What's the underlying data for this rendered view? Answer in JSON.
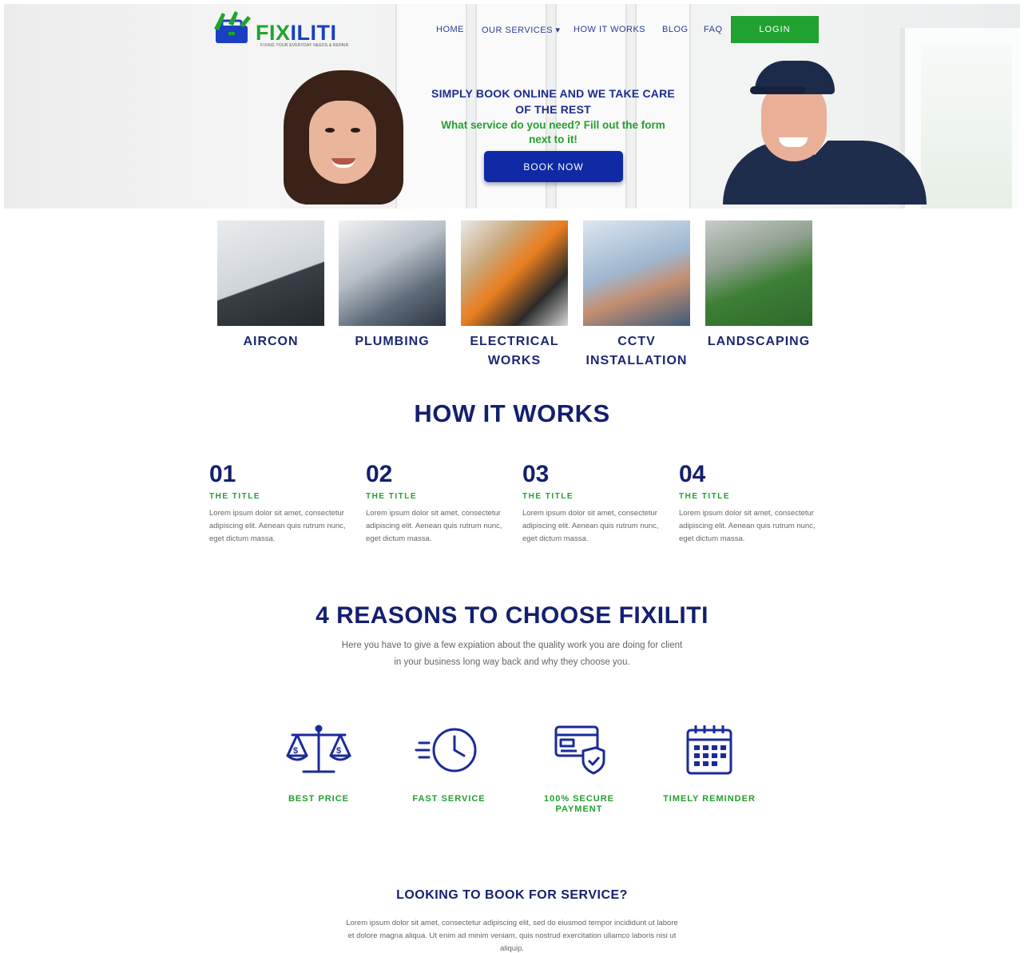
{
  "brand": {
    "logo_text_fix": "FIX",
    "logo_text_iliti": "ILITI",
    "tagline": "FIXING YOUR EVERYDAY NEEDS & REPAIR",
    "colors": {
      "green": "#22a02f",
      "navy": "#141f6f",
      "blue": "#102aa5"
    }
  },
  "nav": {
    "items": [
      "HOME",
      "OUR SERVICES ▾",
      "HOW IT WORKS",
      "BLOG",
      "FAQ"
    ],
    "login_label": "LOGIN"
  },
  "hero": {
    "headline": "SIMPLY BOOK ONLINE AND WE TAKE CARE OF THE REST",
    "subline": "What service do you need? Fill out the form next to it!",
    "cta_label": "BOOK NOW"
  },
  "services": [
    {
      "label": "AIRCON",
      "icon": "aircon-photo"
    },
    {
      "label": "PLUMBING",
      "icon": "plumbing-photo"
    },
    {
      "label": "ELECTRICAL WORKS",
      "icon": "electrical-photo"
    },
    {
      "label": "CCTV INSTALLATION",
      "icon": "cctv-photo"
    },
    {
      "label": "LANDSCAPING",
      "icon": "landscaping-photo"
    }
  ],
  "how_it_works": {
    "title": "HOW IT WORKS",
    "steps": [
      {
        "num": "01",
        "title": "THE TITLE",
        "text": "Lorem ipsum dolor sit amet, consectetur adipiscing elit. Aenean quis rutrum nunc, eget dictum massa."
      },
      {
        "num": "02",
        "title": "THE TITLE",
        "text": "Lorem ipsum dolor sit amet, consectetur adipiscing elit. Aenean quis rutrum nunc, eget dictum massa."
      },
      {
        "num": "03",
        "title": "THE TITLE",
        "text": "Lorem ipsum dolor sit amet, consectetur adipiscing elit. Aenean quis rutrum nunc, eget dictum massa."
      },
      {
        "num": "04",
        "title": "THE TITLE",
        "text": "Lorem ipsum dolor sit amet, consectetur adipiscing elit. Aenean quis rutrum nunc, eget dictum massa."
      }
    ]
  },
  "reasons": {
    "title": "4 REASONS TO CHOOSE FIXILITI",
    "subtitle_l1": "Here you have to give a few expiation about the quality work you are doing for client",
    "subtitle_l2": "in your business long way back and why they choose you.",
    "items": [
      {
        "label": "BEST PRICE",
        "icon": "scale-icon"
      },
      {
        "label": "FAST SERVICE",
        "icon": "clock-icon"
      },
      {
        "label": "100% SECURE PAYMENT",
        "icon": "card-shield-icon"
      },
      {
        "label": "TIMELY REMINDER",
        "icon": "calendar-icon"
      }
    ]
  },
  "book_section": {
    "title": "LOOKING TO BOOK FOR SERVICE?",
    "text": "Lorem ipsum dolor sit amet, consectetur adipiscing elit, sed do eiusmod tempor incididunt ut labore et dolore magna aliqua. Ut enim ad minim veniam, quis nostrud exercitation ullamco laboris nisi ut aliquip."
  }
}
